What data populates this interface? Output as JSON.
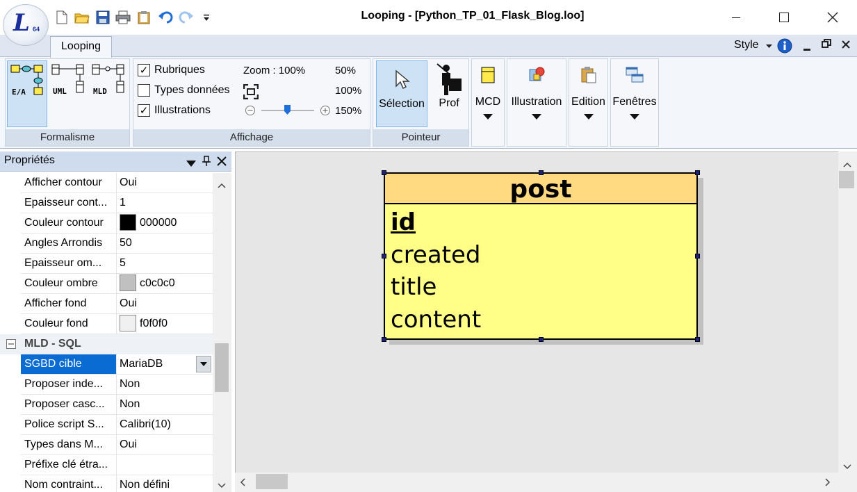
{
  "app": {
    "logo_text": "L",
    "logo_sub": "64",
    "window_title": "Looping - [Python_TP_01_Flask_Blog.loo]"
  },
  "ribbon": {
    "tab": "Looping",
    "style_label": "Style",
    "groups": {
      "formalisme": {
        "label": "Formalisme",
        "buttons": [
          "E/A",
          "UML",
          "MLD"
        ]
      },
      "affichage": {
        "label": "Affichage",
        "rubriques": "Rubriques",
        "types": "Types données",
        "illustrations": "Illustrations",
        "zoom": "Zoom : 100%",
        "z50": "50%",
        "z100": "100%",
        "z150": "150%",
        "zoom_slider_fraction": 0.5
      },
      "pointeur": {
        "label": "Pointeur",
        "selection": "Sélection",
        "prof": "Prof"
      },
      "mcd": "MCD",
      "illustration": "Illustration",
      "edition": "Edition",
      "fenetres": "Fenêtres"
    },
    "checks": {
      "rubriques": true,
      "types": false,
      "illustrations": true
    }
  },
  "properties": {
    "title": "Propriétés",
    "rows": [
      {
        "name": "Afficher contour",
        "value": "Oui"
      },
      {
        "name": "Epaisseur cont...",
        "value": "1"
      },
      {
        "name": "Couleur contour",
        "value": "000000",
        "color": "#000000"
      },
      {
        "name": "Angles Arrondis",
        "value": "50"
      },
      {
        "name": "Epaisseur om...",
        "value": "5"
      },
      {
        "name": "Couleur ombre",
        "value": "c0c0c0",
        "color": "#c0c0c0"
      },
      {
        "name": "Afficher fond",
        "value": "Oui"
      },
      {
        "name": "Couleur fond",
        "value": "f0f0f0",
        "color": "#f0f0f0"
      }
    ],
    "section": "MLD - SQL",
    "rows2": [
      {
        "name": "SGBD cible",
        "value": "MariaDB"
      },
      {
        "name": "Proposer inde...",
        "value": "Non"
      },
      {
        "name": "Proposer casc...",
        "value": "Non"
      },
      {
        "name": "Police script S...",
        "value": "Calibri(10)"
      },
      {
        "name": "Types dans M...",
        "value": "Oui"
      },
      {
        "name": "Préfixe clé étra...",
        "value": ""
      },
      {
        "name": "Nom contraint...",
        "value": "Non défini"
      }
    ]
  },
  "entity": {
    "name": "post",
    "key": "id",
    "attributes": [
      "created",
      "title",
      "content"
    ],
    "header_color": "#ffda80",
    "body_color": "#ffff88"
  }
}
